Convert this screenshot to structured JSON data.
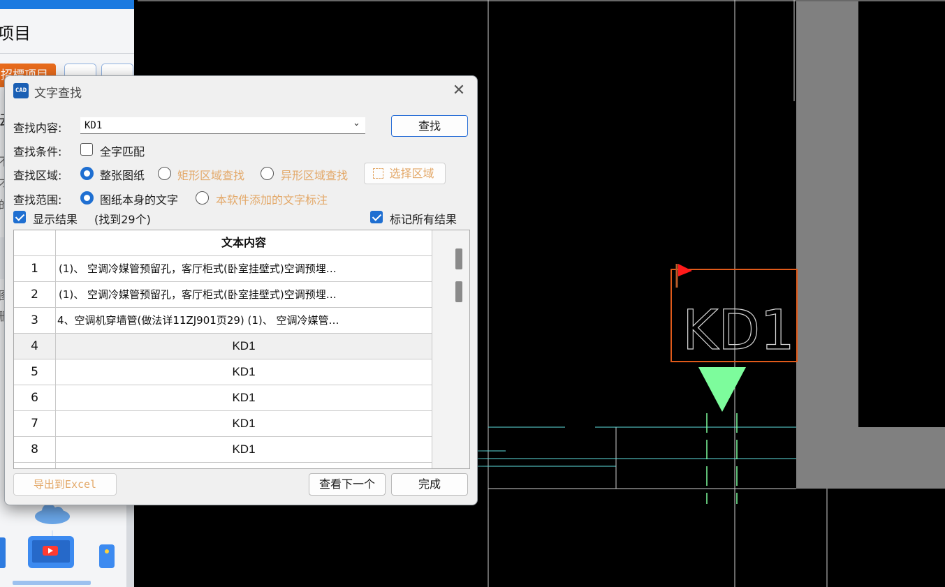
{
  "app": {
    "panel_title": "项目",
    "orange_button": "招標项目",
    "fragments": [
      "云",
      "不",
      "才",
      "的",
      "图",
      "删"
    ]
  },
  "cad": {
    "label": "KD1"
  },
  "dialog": {
    "title": "文字查找",
    "app_icon_text": "CAD",
    "close_symbol": "✕",
    "search": {
      "label": "查找内容:",
      "value": "KD1",
      "button": "查找"
    },
    "conditions": {
      "label": "查找条件:",
      "whole_word": "全字匹配"
    },
    "area": {
      "label": "查找区域:",
      "options": [
        "整张图纸",
        "矩形区域查找",
        "异形区域查找"
      ],
      "select_button": "选择区域"
    },
    "scope": {
      "label": "查找范围:",
      "options": [
        "图纸本身的文字",
        "本软件添加的文字标注"
      ]
    },
    "show_results": "显示结果",
    "found_count": "(找到29个)",
    "mark_all": "标记所有结果",
    "table": {
      "header": "文本内容",
      "rows": [
        {
          "n": "1",
          "text": "(1)、 空调冷媒管预留孔，客厅柜式(卧室挂壁式)空调预埋…"
        },
        {
          "n": "2",
          "text": "(1)、 空调冷媒管预留孔，客厅柜式(卧室挂壁式)空调预埋…"
        },
        {
          "n": "3",
          "text": "4、空调机穿墙管(做法详11ZJ901页29) (1)、 空调冷媒管…"
        },
        {
          "n": "4",
          "text": "KD1"
        },
        {
          "n": "5",
          "text": "KD1"
        },
        {
          "n": "6",
          "text": "KD1"
        },
        {
          "n": "7",
          "text": "KD1"
        },
        {
          "n": "8",
          "text": "KD1"
        }
      ]
    },
    "buttons": {
      "export": "导出到Excel",
      "next": "查看下一个",
      "done": "完成"
    }
  },
  "colors": {
    "accent": "#1f6fd1",
    "muted_text": "#e3a868",
    "cad_highlight": "#e05a1a",
    "cad_marker": "#7dfc9c",
    "cad_flag": "#ff1a1a"
  }
}
